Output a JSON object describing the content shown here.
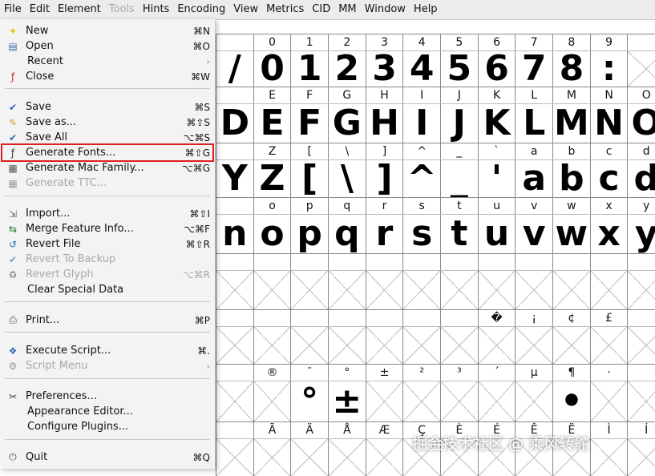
{
  "menubar": {
    "items": [
      {
        "label": "File",
        "disabled": false
      },
      {
        "label": "Edit",
        "disabled": false
      },
      {
        "label": "Element",
        "disabled": false
      },
      {
        "label": "Tools",
        "disabled": true
      },
      {
        "label": "Hints",
        "disabled": false
      },
      {
        "label": "Encoding",
        "disabled": false
      },
      {
        "label": "View",
        "disabled": false
      },
      {
        "label": "Metrics",
        "disabled": false
      },
      {
        "label": "CID",
        "disabled": false
      },
      {
        "label": "MM",
        "disabled": false
      },
      {
        "label": "Window",
        "disabled": false
      },
      {
        "label": "Help",
        "disabled": false
      }
    ]
  },
  "file_menu": {
    "items": [
      {
        "label": "New",
        "shortcut": "⌘N"
      },
      {
        "label": "Open",
        "shortcut": "⌘O"
      },
      {
        "label": "Recent",
        "shortcut": "›"
      },
      {
        "label": "Close",
        "shortcut": "⌘W"
      },
      {
        "label": "Save",
        "shortcut": "⌘S"
      },
      {
        "label": "Save as...",
        "shortcut": "⌘⇧S"
      },
      {
        "label": "Save All",
        "shortcut": "⌥⌘S"
      },
      {
        "label": "Generate Fonts...",
        "shortcut": "⌘⇧G"
      },
      {
        "label": "Generate Mac Family...",
        "shortcut": "⌥⌘G"
      },
      {
        "label": "Generate TTC...",
        "shortcut": ""
      },
      {
        "label": "Import...",
        "shortcut": "⌘⇧I"
      },
      {
        "label": "Merge Feature Info...",
        "shortcut": "⌥⌘F"
      },
      {
        "label": "Revert File",
        "shortcut": "⌘⇧R"
      },
      {
        "label": "Revert To Backup",
        "shortcut": ""
      },
      {
        "label": "Revert Glyph",
        "shortcut": "⌥⌘R"
      },
      {
        "label": "Clear Special Data",
        "shortcut": ""
      },
      {
        "label": "Print...",
        "shortcut": "⌘P"
      },
      {
        "label": "Execute Script...",
        "shortcut": "⌘."
      },
      {
        "label": "Script Menu",
        "shortcut": "›"
      },
      {
        "label": "Preferences...",
        "shortcut": ""
      },
      {
        "label": "Appearance Editor...",
        "shortcut": ""
      },
      {
        "label": "Configure Plugins...",
        "shortcut": ""
      },
      {
        "label": "Quit",
        "shortcut": "⌘Q"
      }
    ]
  },
  "glyph_grid": {
    "rows": [
      {
        "labels": [
          "",
          "0",
          "1",
          "2",
          "3",
          "4",
          "5",
          "6",
          "7",
          "8",
          "9"
        ],
        "glyphs": [
          "/",
          "0",
          "1",
          "2",
          "3",
          "4",
          "5",
          "6",
          "7",
          "8",
          ":"
        ]
      },
      {
        "labels": [
          "",
          "E",
          "F",
          "G",
          "H",
          "I",
          "J",
          "K",
          "L",
          "M",
          "N",
          "O"
        ],
        "glyphs": [
          "D",
          "E",
          "F",
          "G",
          "H",
          "I",
          "J",
          "K",
          "L",
          "M",
          "N",
          "O"
        ]
      },
      {
        "labels": [
          "",
          "Z",
          "[",
          "\\",
          "]",
          "^",
          "_",
          "`",
          "a",
          "b",
          "c",
          "d"
        ],
        "glyphs": [
          "Y",
          "Z",
          "[",
          "\\",
          "]",
          "^",
          "_",
          "'",
          "a",
          "b",
          "c",
          "d"
        ]
      },
      {
        "labels": [
          "",
          "o",
          "p",
          "q",
          "r",
          "s",
          "t",
          "u",
          "v",
          "w",
          "x",
          "y"
        ],
        "glyphs": [
          "n",
          "o",
          "p",
          "q",
          "r",
          "s",
          "t",
          "u",
          "v",
          "w",
          "x",
          "y"
        ]
      },
      {
        "labels": [
          "",
          "",
          "",
          "",
          "",
          "",
          "",
          "",
          "",
          "",
          "",
          ""
        ],
        "glyphs": [
          "",
          "",
          "",
          "",
          "",
          "",
          "",
          "",
          "",
          "",
          "",
          ""
        ]
      },
      {
        "labels": [
          "",
          "",
          "",
          "",
          "",
          "",
          "",
          "�",
          "¡",
          "¢",
          "£"
        ],
        "glyphs": [
          "",
          "",
          "",
          "",
          "",
          "",
          "",
          "",
          "",
          "",
          "",
          ""
        ]
      },
      {
        "labels": [
          "",
          "®",
          "¯",
          "°",
          "±",
          "²",
          "³",
          "´",
          "µ",
          "¶",
          "·"
        ],
        "glyphs": [
          "",
          "",
          "°",
          "±",
          "",
          "",
          "",
          "",
          "",
          "•",
          ""
        ]
      },
      {
        "labels": [
          "",
          "Ã",
          "Ä",
          "Å",
          "Æ",
          "Ç",
          "È",
          "É",
          "Ê",
          "Ë",
          "Ì",
          "Í"
        ],
        "glyphs": [
          "",
          "",
          "",
          "",
          "",
          "",
          "",
          "",
          "",
          "",
          "",
          ""
        ]
      }
    ]
  },
  "watermark": "掘金技术社区 @ 乘风转舵"
}
